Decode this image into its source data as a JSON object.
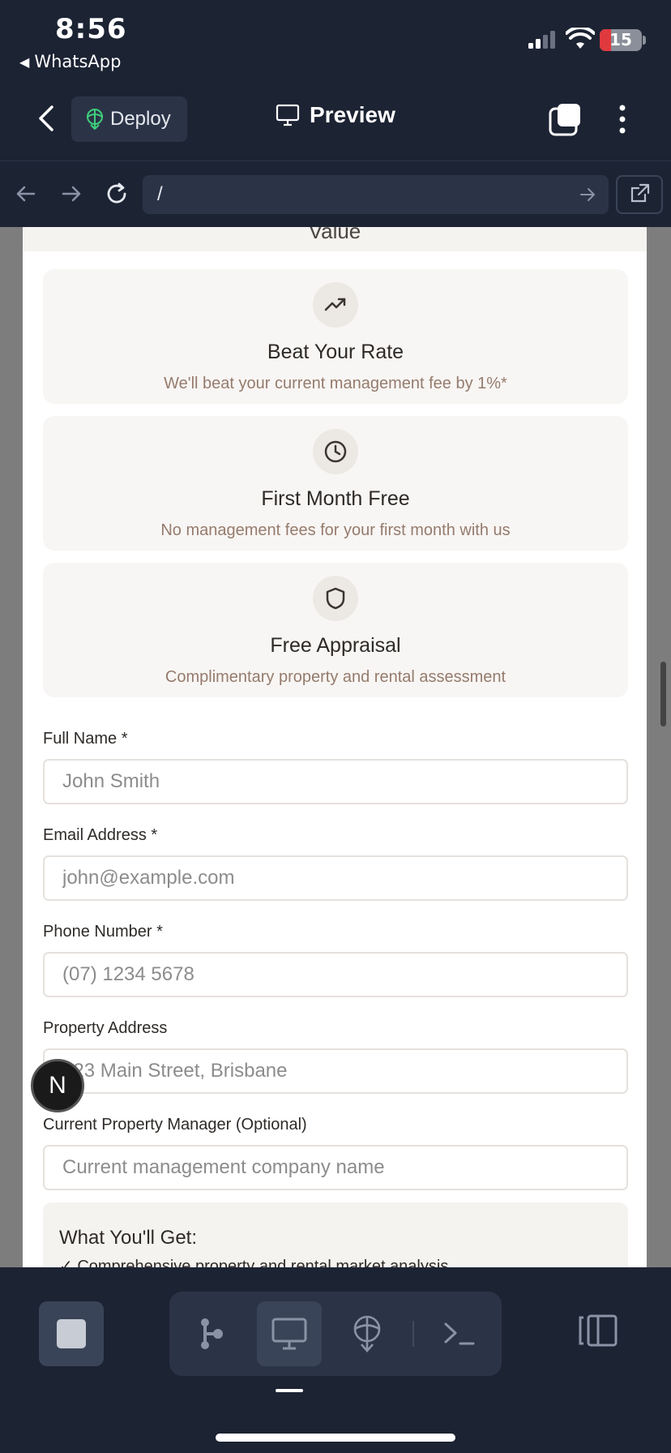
{
  "status_bar": {
    "time": "8:56",
    "back_app": "WhatsApp",
    "battery_level": "15",
    "battery_color": "#e0393e"
  },
  "toolbar": {
    "back_icon": "chevron-left-icon",
    "deploy_label": "Deploy",
    "preview_label": "Preview",
    "accent_color": "#3ecf7a"
  },
  "url_bar": {
    "url": "/"
  },
  "page": {
    "header_partial": "Value",
    "cards": [
      {
        "icon": "trending-up-icon",
        "title": "Beat Your Rate",
        "description": "We'll beat your current management fee by 1%*"
      },
      {
        "icon": "clock-icon",
        "title": "First Month Free",
        "description": "No management fees for your first month with us"
      },
      {
        "icon": "shield-icon",
        "title": "Free Appraisal",
        "description": "Complimentary property and rental assessment"
      }
    ],
    "form": {
      "full_name": {
        "label": "Full Name *",
        "placeholder": "John Smith"
      },
      "email": {
        "label": "Email Address *",
        "placeholder": "john@example.com"
      },
      "phone": {
        "label": "Phone Number *",
        "placeholder": "(07) 1234 5678"
      },
      "address": {
        "label": "Property Address",
        "placeholder": "123 Main Street, Brisbane"
      },
      "manager": {
        "label": "Current Property Manager (Optional)",
        "placeholder": "Current management company name"
      }
    },
    "what_you_get": {
      "title": "What You'll Get:",
      "items": [
        "✓ Comprehensive property and rental market analysis"
      ]
    },
    "badge_letter": "N"
  }
}
